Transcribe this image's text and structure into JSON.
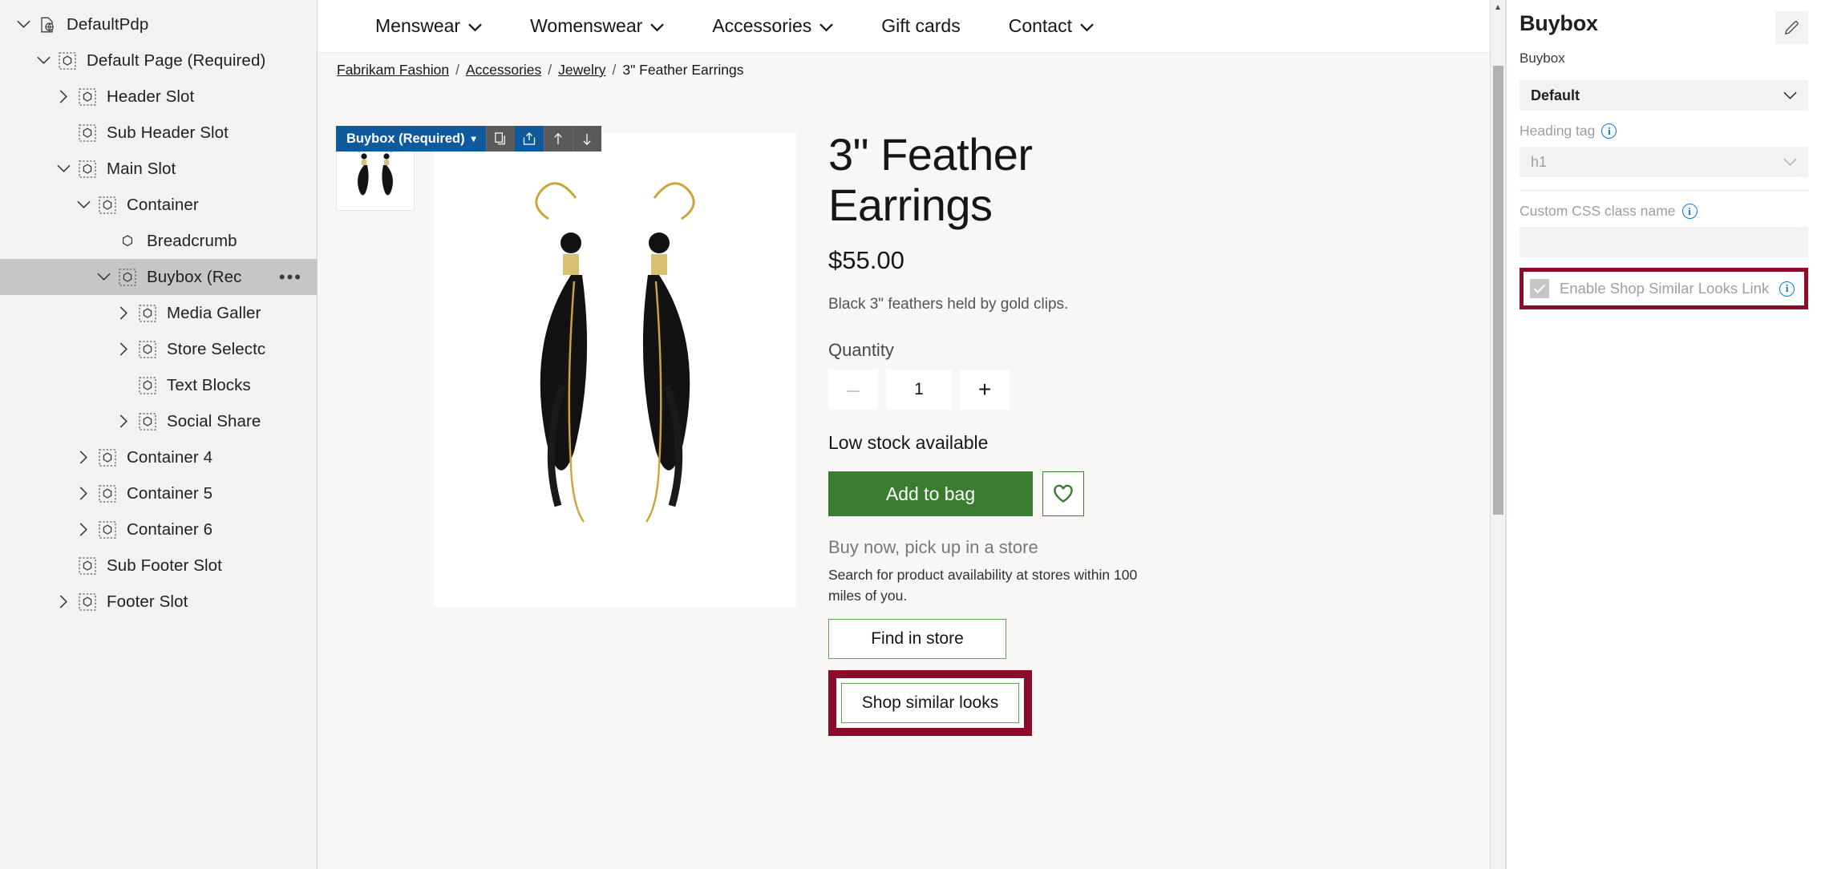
{
  "tree": {
    "items": [
      {
        "label": "DefaultPdp",
        "indent": 0,
        "chevron": "down",
        "icon": "page-globe-icon",
        "selected": false,
        "menu": false
      },
      {
        "label": "Default Page (Required)",
        "indent": 1,
        "chevron": "down",
        "icon": "slot-icon",
        "selected": false,
        "menu": false
      },
      {
        "label": "Header Slot",
        "indent": 2,
        "chevron": "right",
        "icon": "slot-icon",
        "selected": false,
        "menu": false
      },
      {
        "label": "Sub Header Slot",
        "indent": 2,
        "chevron": "none",
        "icon": "slot-icon",
        "selected": false,
        "menu": false
      },
      {
        "label": "Main Slot",
        "indent": 2,
        "chevron": "down",
        "icon": "slot-icon",
        "selected": false,
        "menu": false
      },
      {
        "label": "Container",
        "indent": 3,
        "chevron": "down",
        "icon": "slot-icon",
        "selected": false,
        "menu": false
      },
      {
        "label": "Breadcrumb",
        "indent": 4,
        "chevron": "none",
        "icon": "module-icon",
        "selected": false,
        "menu": false
      },
      {
        "label": "Buybox (Rec",
        "indent": 4,
        "chevron": "down",
        "icon": "slot-icon",
        "selected": true,
        "menu": true
      },
      {
        "label": "Media Galler",
        "indent": 5,
        "chevron": "right",
        "icon": "slot-icon",
        "selected": false,
        "menu": false
      },
      {
        "label": "Store Selectc",
        "indent": 5,
        "chevron": "right",
        "icon": "slot-icon",
        "selected": false,
        "menu": false
      },
      {
        "label": "Text Blocks",
        "indent": 5,
        "chevron": "none",
        "icon": "slot-icon",
        "selected": false,
        "menu": false
      },
      {
        "label": "Social Share",
        "indent": 5,
        "chevron": "right",
        "icon": "slot-icon",
        "selected": false,
        "menu": false
      },
      {
        "label": "Container 4",
        "indent": 3,
        "chevron": "right",
        "icon": "slot-icon",
        "selected": false,
        "menu": false
      },
      {
        "label": "Container 5",
        "indent": 3,
        "chevron": "right",
        "icon": "slot-icon",
        "selected": false,
        "menu": false
      },
      {
        "label": "Container 6",
        "indent": 3,
        "chevron": "right",
        "icon": "slot-icon",
        "selected": false,
        "menu": false
      },
      {
        "label": "Sub Footer Slot",
        "indent": 2,
        "chevron": "none",
        "icon": "slot-icon",
        "selected": false,
        "menu": false
      },
      {
        "label": "Footer Slot",
        "indent": 2,
        "chevron": "right",
        "icon": "slot-icon",
        "selected": false,
        "menu": false
      }
    ],
    "more_menu_label": "•••"
  },
  "site_nav": {
    "items": [
      {
        "label": "Menswear",
        "caret": true
      },
      {
        "label": "Womenswear",
        "caret": true
      },
      {
        "label": "Accessories",
        "caret": true
      },
      {
        "label": "Gift cards",
        "caret": false
      },
      {
        "label": "Contact",
        "caret": true
      }
    ]
  },
  "breadcrumb": {
    "links": [
      "Fabrikam Fashion",
      "Accessories",
      "Jewelry"
    ],
    "separator": "/",
    "current": "3\" Feather Earrings"
  },
  "module_toolbar": {
    "chip_label": "Buybox (Required)",
    "chip_caret": "▾",
    "buttons": [
      {
        "name": "copy-module-button",
        "glyph": "copy-icon",
        "accent": false
      },
      {
        "name": "share-module-button",
        "glyph": "share-icon",
        "accent": true
      },
      {
        "name": "move-up-button",
        "glyph": "arrow-up-icon",
        "accent": false
      },
      {
        "name": "move-down-button",
        "glyph": "arrow-down-icon",
        "accent": false
      }
    ]
  },
  "product": {
    "title": "3\" Feather Earrings",
    "price": "$55.00",
    "description": "Black 3\" feathers held by gold clips.",
    "quantity_label": "Quantity",
    "quantity_value": "1",
    "decrement_glyph": "–",
    "increment_glyph": "+",
    "stock_status": "Low stock available",
    "add_to_bag_label": "Add to bag",
    "wishlist_icon": "heart-icon",
    "pickup_heading": "Buy now, pick up in a store",
    "pickup_text": "Search for product availability at stores within 100 miles of you.",
    "find_in_store_label": "Find in store",
    "shop_similar_looks_label": "Shop similar looks",
    "image_alt": "black-feather-earrings"
  },
  "properties": {
    "title": "Buybox",
    "subtitle": "Buybox",
    "edit_icon": "pencil-icon",
    "layout_value": "Default",
    "heading_tag_label": "Heading tag",
    "heading_tag_value": "h1",
    "custom_css_label": "Custom CSS class name",
    "custom_css_value": "",
    "checkbox_label": "Enable Shop Similar Looks Link",
    "checkbox_checked": true,
    "info_glyph": "i"
  },
  "colors": {
    "highlight": "#8c0b29",
    "accent_blue": "#0f5a9c",
    "green": "#3b7d30",
    "info_blue": "#0078d4"
  }
}
